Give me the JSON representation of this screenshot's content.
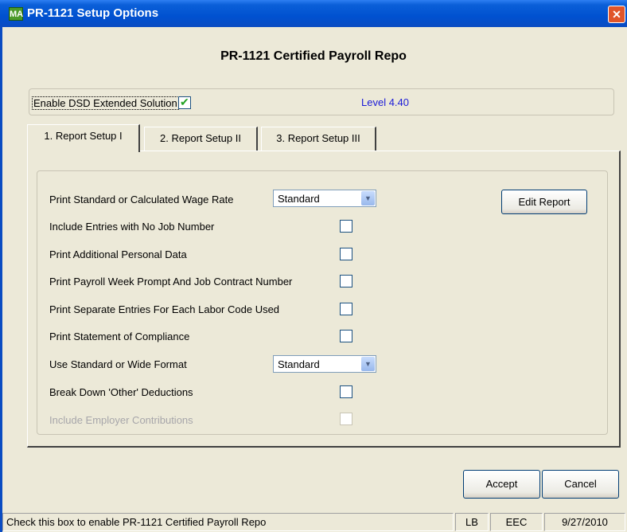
{
  "window": {
    "title": "PR-1121 Setup Options",
    "app_icon": "MA",
    "close_glyph": "✕"
  },
  "heading": "PR-1121 Certified Payroll Repo",
  "enable": {
    "label": "Enable DSD Extended Solution",
    "checked": true,
    "level": "Level  4.40"
  },
  "tabs": [
    {
      "label": "1. Report Setup I",
      "active": true
    },
    {
      "label": "2. Report Setup II",
      "active": false
    },
    {
      "label": "3. Report Setup III",
      "active": false
    }
  ],
  "options": {
    "wage_rate": {
      "label": "Print Standard or Calculated Wage Rate",
      "value": "Standard"
    },
    "no_job_number": {
      "label": "Include Entries with No Job Number",
      "checked": false
    },
    "personal_data": {
      "label": "Print Additional Personal Data",
      "checked": false
    },
    "week_prompt": {
      "label": "Print Payroll Week Prompt And Job Contract Number",
      "checked": false
    },
    "separate_entries": {
      "label": "Print Separate Entries For Each Labor Code Used",
      "checked": false
    },
    "compliance": {
      "label": "Print Statement of Compliance",
      "checked": false
    },
    "format": {
      "label": "Use Standard or Wide Format",
      "value": "Standard"
    },
    "other_deductions": {
      "label": "Break Down 'Other' Deductions",
      "checked": false
    },
    "employer_contrib": {
      "label": "Include Employer Contributions",
      "checked": false,
      "disabled": true
    }
  },
  "buttons": {
    "edit_report": "Edit Report",
    "accept": "Accept",
    "cancel": "Cancel"
  },
  "status": {
    "message": "Check this box to enable PR-1121 Certified Payroll Repo",
    "user": "LB",
    "company": "EEC",
    "date": "9/27/2010"
  }
}
